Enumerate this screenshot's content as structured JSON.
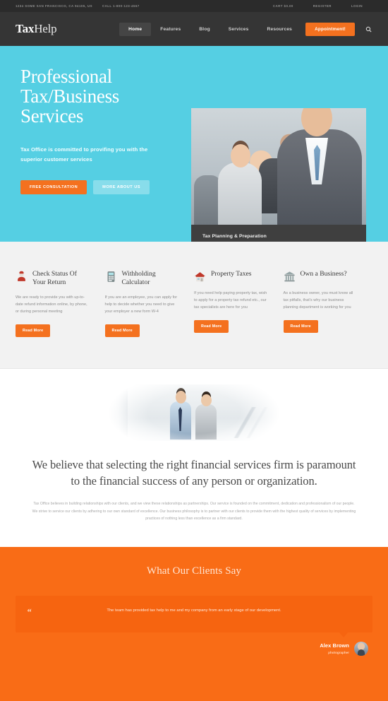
{
  "topbar": {
    "address": "1234 SOME SAN FRANCISCO, CA 94105, US",
    "phone": "CALL 1-800-123-4567",
    "cart": "CART $0.00",
    "register": "REGISTER",
    "login": "LOGIN"
  },
  "header": {
    "logo_bold": "Tax",
    "logo_light": "Help",
    "nav": [
      {
        "label": "Home"
      },
      {
        "label": "Features"
      },
      {
        "label": "Blog"
      },
      {
        "label": "Services"
      },
      {
        "label": "Resources"
      }
    ],
    "cta_label": "Appointment!",
    "search_icon": "search-icon",
    "search_glyph": "⌕"
  },
  "hero": {
    "title": "Professional Tax/Business Services",
    "subtitle": "Tax Office is committed to provifing you with the superior customer services",
    "primary_btn": "FREE CONSULTATION",
    "secondary_btn": "MORE ABOUT US",
    "caption": "Tax Planning & Preparation"
  },
  "services": [
    {
      "icon": "person-icon",
      "title": "Check Status Of Your Return",
      "text": "We are ready to provide you with up-to-date refund information online, by phone, or during personal meeting",
      "button": "Read More"
    },
    {
      "icon": "calculator-icon",
      "title": "Withholding Calculator",
      "text": "If you are an employee, you can apply for help to decide whether you need to give your employer a new form W-4",
      "button": "Read More"
    },
    {
      "icon": "house-icon",
      "title": "Property Taxes",
      "text": "If you need help paying property tax, wish to apply for a property tax refund etc., our tax specialists are here for you",
      "button": "Read More"
    },
    {
      "icon": "bank-icon",
      "title": "Own a Business?",
      "text": "As a business owner, you must know all tax pitfalls, that's why our business planning department is working for you",
      "button": "Read More"
    }
  ],
  "believe": {
    "heading": "We believe that selecting the right financial services firm is paramount to the financial success of any person or organization.",
    "paragraph": "Tax Office believes in building relationships with our clients, and we view these relationships as partnerships. Our service is founded on the commitment, dedication and professionalism of our people. We strive to service our clients by adhering to our own standard of excellence. Our business philosophy is to partner with our clients to provide them with the highest quality of services by implementing practices of nothing less than excellence as a firm standard."
  },
  "testimonials": {
    "heading": "What Our Clients Say",
    "quote_glyph": "“",
    "text": "The team has provided tax help to me and my company from an early stage of our development.",
    "author_name": "Alex Brown",
    "author_role": "photographer"
  },
  "colors": {
    "accent_orange": "#f4711f",
    "hero_cyan": "#55cfe3",
    "dark_header": "#353535",
    "topbar_dark": "#2b2b2b",
    "testimonial_orange": "#f96c16"
  }
}
